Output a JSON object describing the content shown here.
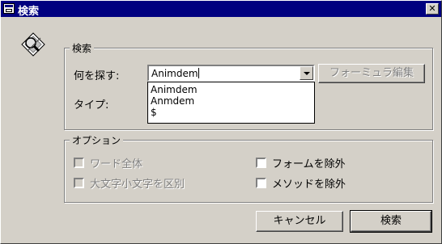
{
  "window": {
    "title": "検索",
    "close_symbol": "✕"
  },
  "search_group": {
    "legend": "検索",
    "find_label": "何を探す:",
    "find_value": "Animdem",
    "history": [
      "Animdem",
      "Anmdem",
      "$"
    ],
    "type_label": "タイプ:"
  },
  "formula_button": "フォーミュラ編集",
  "options_group": {
    "legend": "オプション",
    "whole_word": "ワード全体",
    "match_case": "大文字小文字を区別",
    "exclude_forms": "フォームを除外",
    "exclude_methods": "メソッドを除外"
  },
  "buttons": {
    "cancel": "キャンセル",
    "search": "検索"
  }
}
